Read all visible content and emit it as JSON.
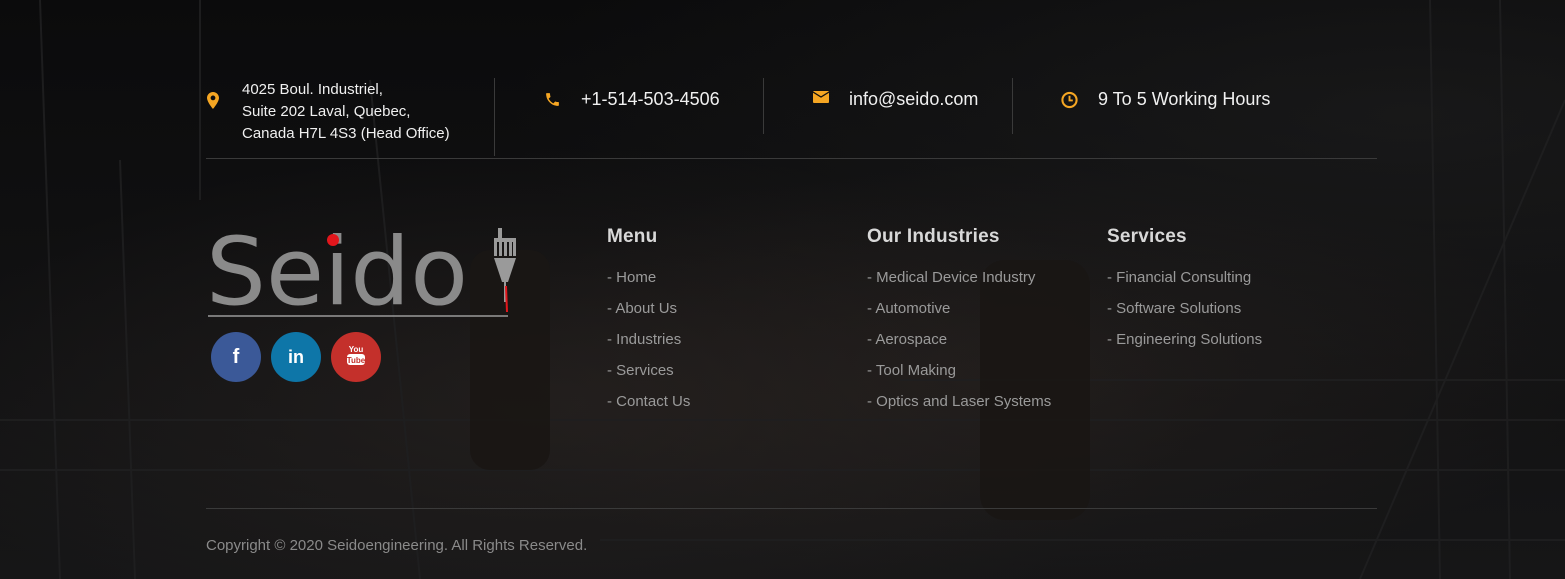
{
  "contact": {
    "address_line1": "4025 Boul. Industriel,",
    "address_line2": "Suite 202 Laval, Quebec,",
    "address_line3": "Canada H7L 4S3 (Head Office)",
    "phone": "+1-514-503-4506",
    "email": "info@seido.com",
    "hours": "9 To 5 Working Hours",
    "icon_color": "#f5a623"
  },
  "logo": {
    "text": "Seido"
  },
  "socials": [
    {
      "name": "facebook-icon",
      "glyph": "f",
      "color": "#3b5998"
    },
    {
      "name": "linkedin-icon",
      "glyph": "in",
      "color": "#0e76a8"
    },
    {
      "name": "youtube-icon",
      "glyph": "You Tube",
      "color": "#c4302b"
    }
  ],
  "menu": {
    "title": "Menu",
    "items": [
      "- Home",
      "- About Us",
      "- Industries",
      "- Services",
      "- Contact Us"
    ]
  },
  "industries": {
    "title": "Our Industries",
    "items": [
      "- Medical Device Industry",
      "- Automotive",
      "- Aerospace",
      "- Tool Making",
      "- Optics and Laser Systems"
    ]
  },
  "services": {
    "title": "Services",
    "items": [
      "- Financial Consulting",
      "- Software Solutions",
      "- Engineering Solutions"
    ]
  },
  "copyright": "Copyright © 2020 Seidoengineering. All Rights Reserved."
}
